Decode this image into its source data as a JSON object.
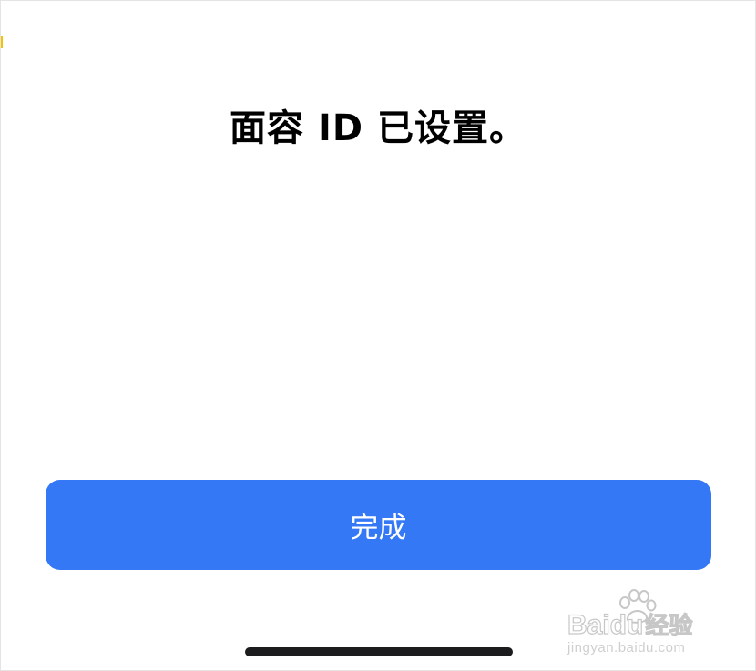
{
  "setup": {
    "title": "面容 ID 已设置。",
    "done_label": "完成"
  },
  "watermark": {
    "logo_text": "Baidu",
    "logo_cn": "经验",
    "url": "jingyan.baidu.com"
  },
  "colors": {
    "button": "#3478f6",
    "button_text": "#ffffff",
    "title_text": "#000000",
    "home_indicator": "#1c1c1e"
  }
}
